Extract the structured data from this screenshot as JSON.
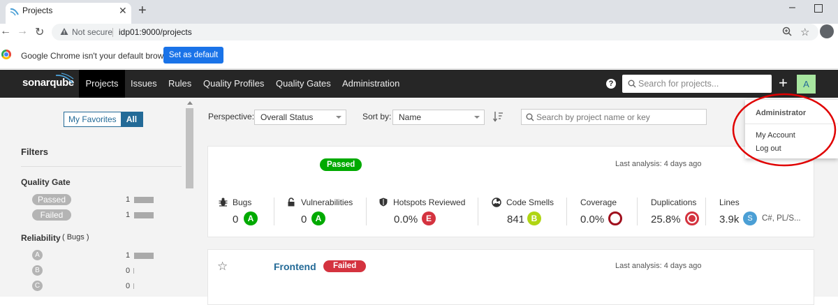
{
  "browser": {
    "tab_title": "Projects",
    "new_tab_label": "+",
    "close_tab_label": "✕",
    "not_secure_label": "Not secure",
    "url": "idp01:9000/projects",
    "infobar_message": "Google Chrome isn't your default browser",
    "set_default_label": "Set as default"
  },
  "nav": {
    "logo": "sonarqube",
    "items": [
      {
        "label": "Projects",
        "active": true
      },
      {
        "label": "Issues"
      },
      {
        "label": "Rules"
      },
      {
        "label": "Quality Profiles"
      },
      {
        "label": "Quality Gates"
      },
      {
        "label": "Administration"
      }
    ],
    "help_label": "?",
    "search_placeholder": "Search for projects...",
    "plus_label": "+",
    "avatar_letter": "A"
  },
  "user_menu": {
    "header": "Administrator",
    "items": [
      "My Account",
      "Log out"
    ]
  },
  "sidebar": {
    "favorites_toggle": {
      "my_favorites": "My Favorites",
      "all": "All"
    },
    "filters_title": "Filters",
    "quality_gate": {
      "title": "Quality Gate",
      "options": [
        {
          "label": "Passed",
          "count": "1",
          "fraction": 1
        },
        {
          "label": "Failed",
          "count": "1",
          "fraction": 1
        }
      ]
    },
    "reliability": {
      "title": "Reliability",
      "subtitle": "( Bugs )",
      "options": [
        {
          "label": "A",
          "count": "1",
          "fraction": 1
        },
        {
          "label": "B",
          "count": "0",
          "fraction": 0
        },
        {
          "label": "C",
          "count": "0",
          "fraction": 0
        }
      ]
    }
  },
  "toolbar": {
    "perspective_label": "Perspective:",
    "perspective_value": "Overall Status",
    "sort_label": "Sort by:",
    "sort_value": "Name",
    "search_placeholder": "Search by project name or key"
  },
  "projects": [
    {
      "name": "",
      "status": "Passed",
      "status_color": "#00aa00",
      "last_analysis": "Last analysis: 4 days ago",
      "measures": {
        "bugs": {
          "label": "Bugs",
          "value": "0",
          "rating": "A",
          "rating_color": "#00aa00"
        },
        "vulnerabilities": {
          "label": "Vulnerabilities",
          "value": "0",
          "rating": "A",
          "rating_color": "#00aa00"
        },
        "hotspots": {
          "label": "Hotspots Reviewed",
          "value": "0.0%",
          "rating": "E",
          "rating_color": "#d4333f"
        },
        "code_smells": {
          "label": "Code Smells",
          "value": "841",
          "rating": "B",
          "rating_color": "#b0d513"
        },
        "coverage": {
          "label": "Coverage",
          "value": "0.0%"
        },
        "duplications": {
          "label": "Duplications",
          "value": "25.8%"
        },
        "lines": {
          "label": "Lines",
          "value": "3.9k",
          "size_badge": "S",
          "languages": "C#, PL/S..."
        }
      }
    },
    {
      "name": "Frontend",
      "status": "Failed",
      "status_color": "#d4333f",
      "last_analysis": "Last analysis: 4 days ago"
    }
  ],
  "colors": {
    "nav_bg": "#262626",
    "accent": "#236a97",
    "annotation_circle": "#e00000"
  }
}
